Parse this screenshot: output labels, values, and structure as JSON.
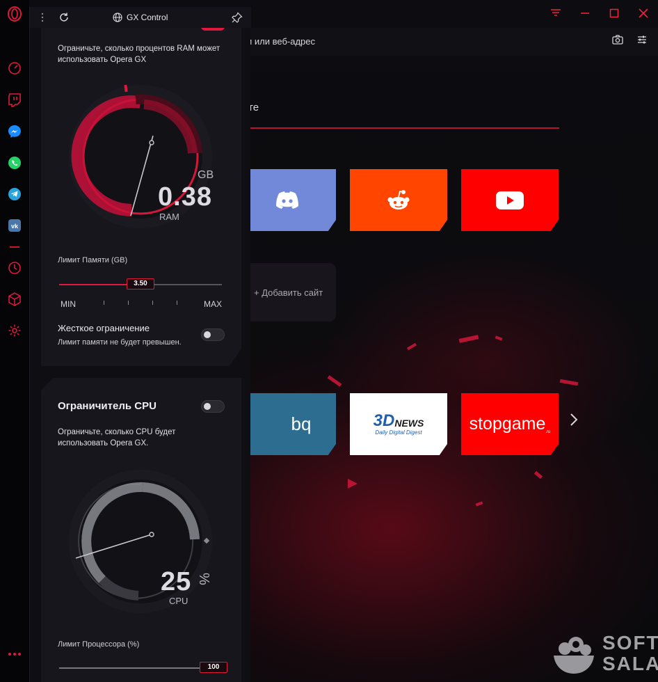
{
  "window": {
    "controls": [
      "menu-icon",
      "minimize-icon",
      "maximize-icon",
      "close-icon"
    ],
    "accent_color": "#f0223c"
  },
  "browser": {
    "address_placeholder": "и или веб-адрес",
    "search_text": "те",
    "add_site_label": "+ Добавить сайт",
    "speed_dial": [
      {
        "name": "Discord",
        "color": "#7289da",
        "icon": "discord-icon"
      },
      {
        "name": "Reddit",
        "color": "#ff4500",
        "icon": "reddit-icon"
      },
      {
        "name": "YouTube",
        "color": "#ff0000",
        "icon": "youtube-icon"
      },
      {
        "name": "bq",
        "color": "#2d6d8f",
        "label": "bq"
      },
      {
        "name": "3DNews",
        "color": "#ffffff",
        "label_main": "3D",
        "label_news": "NEWS",
        "label_sub": "Daily Digital Digest"
      },
      {
        "name": "stopgame",
        "color": "#ff0000",
        "label": "stopgame",
        "label_suffix": ".ru"
      }
    ]
  },
  "sidebar": {
    "items": [
      "opera-gx-logo-icon",
      "speedometer-icon",
      "twitch-icon",
      "messenger-icon",
      "whatsapp-icon",
      "telegram-icon",
      "vk-icon",
      "history-icon",
      "cube-icon",
      "settings-icon",
      "more-icon"
    ]
  },
  "gx_control": {
    "title": "GX Control",
    "ram": {
      "description": "Ограничьте, сколько процентов RAM может использовать Opera GX",
      "unit_top": "GB",
      "value": "0.38",
      "unit_bottom": "RAM",
      "limit_label": "Лимит Памяти (GB)",
      "limit_value": "3.50",
      "limit_fraction": 0.5,
      "min_label": "MIN",
      "max_label": "MAX",
      "hard_limit_title": "Жесткое ограничение",
      "hard_limit_desc": "Лимит памяти не будет превышен.",
      "hard_limit_enabled": false
    },
    "cpu": {
      "title": "Ограничитель CPU",
      "enabled": false,
      "description": "Ограничьте, сколько CPU будет использовать Opera GX.",
      "value": "25",
      "unit_symbol": "%",
      "unit_bottom": "CPU",
      "limit_label": "Лимит Процессора (%)",
      "limit_value": "100",
      "limit_fraction": 1.0
    }
  },
  "watermark": {
    "line1": "SOFT",
    "line2": "SALAD"
  }
}
